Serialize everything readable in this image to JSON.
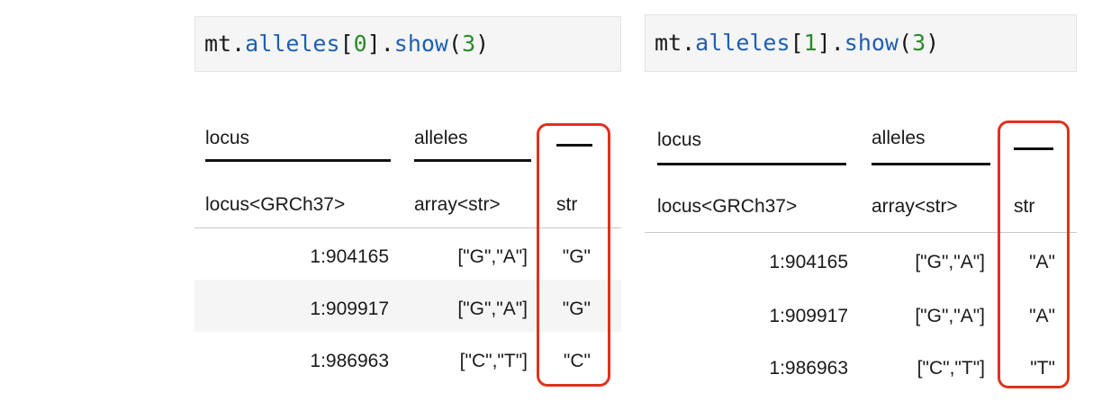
{
  "cells": [
    {
      "code": {
        "obj": "mt",
        "dot1": ".",
        "attr": "alleles",
        "lb": "[",
        "index": "0",
        "rb": "]",
        "dot2": ".",
        "method": "show",
        "lp": "(",
        "arg": "3",
        "rp": ")"
      },
      "table": {
        "headers": [
          "locus",
          "alleles",
          ""
        ],
        "types": [
          "locus<GRCh37>",
          "array<str>",
          "str"
        ],
        "rows": [
          [
            "1:904165",
            "[\"G\",\"A\"]",
            "\"G\""
          ],
          [
            "1:909917",
            "[\"G\",\"A\"]",
            "\"G\""
          ],
          [
            "1:986963",
            "[\"C\",\"T\"]",
            "\"C\""
          ]
        ]
      }
    },
    {
      "code": {
        "obj": "mt",
        "dot1": ".",
        "attr": "alleles",
        "lb": "[",
        "index": "1",
        "rb": "]",
        "dot2": ".",
        "method": "show",
        "lp": "(",
        "arg": "3",
        "rp": ")"
      },
      "table": {
        "headers": [
          "locus",
          "alleles",
          ""
        ],
        "types": [
          "locus<GRCh37>",
          "array<str>",
          "str"
        ],
        "rows": [
          [
            "1:904165",
            "[\"G\",\"A\"]",
            "\"A\""
          ],
          [
            "1:909917",
            "[\"G\",\"A\"]",
            "\"A\""
          ],
          [
            "1:986963",
            "[\"C\",\"T\"]",
            "\"T\""
          ]
        ]
      }
    }
  ],
  "colors": {
    "highlight": "#e0311e",
    "attribute": "#1f5fb0",
    "number": "#2a8a2a",
    "code_bg": "#f5f5f5"
  }
}
